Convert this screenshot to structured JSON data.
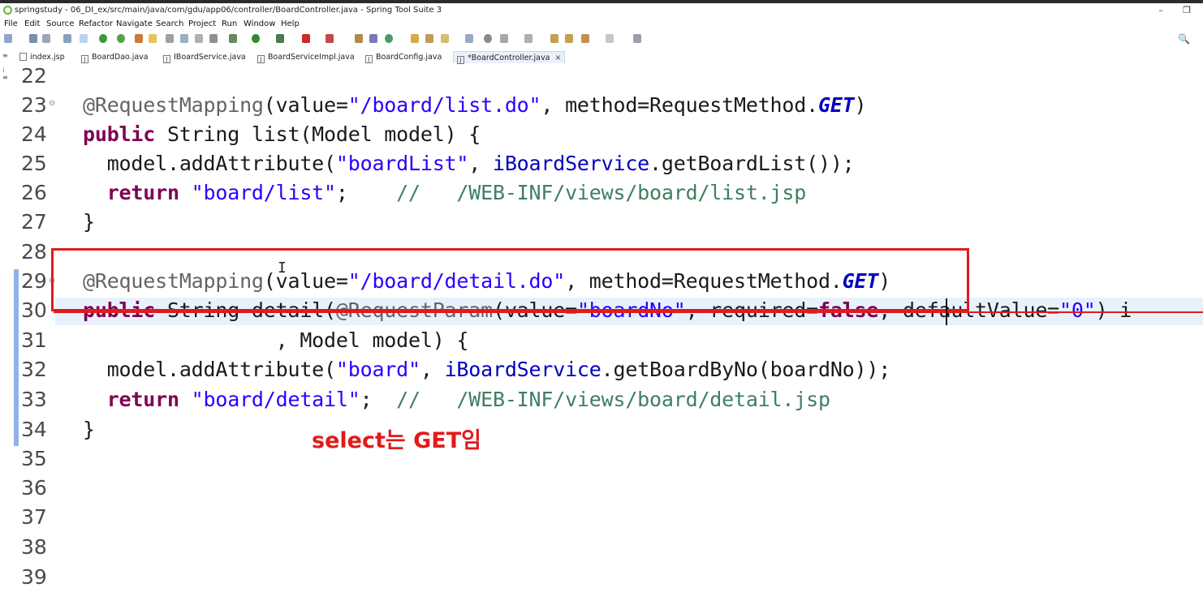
{
  "window": {
    "title": "springstudy - 06_DI_ex/src/main/java/com/gdu/app06/controller/BoardController.java - Spring Tool Suite 3",
    "minimize": "–",
    "restore": "❐"
  },
  "menu": [
    "File",
    "Edit",
    "Source",
    "Refactor",
    "Navigate",
    "Search",
    "Project",
    "Run",
    "Window",
    "Help"
  ],
  "toolbar": {
    "search_icon": "search-icon"
  },
  "tabs": [
    {
      "label": "index.jsp",
      "icon": "J"
    },
    {
      "label": "BoardDao.java",
      "icon": "J"
    },
    {
      "label": "IBoardService.java",
      "icon": "J"
    },
    {
      "label": "BoardServiceImpl.java",
      "icon": "J"
    },
    {
      "label": "BoardConfig.java",
      "icon": "J"
    },
    {
      "label": "*BoardController.java",
      "icon": "J",
      "close": "×"
    }
  ],
  "editor": {
    "line_numbers": [
      "22",
      "23",
      "24",
      "25",
      "26",
      "27",
      "28",
      "29",
      "30",
      "31",
      "32",
      "33",
      "34",
      "35",
      "36",
      "37",
      "38",
      "39"
    ],
    "fold_markers": {
      "23": "⊖",
      "29": "⊖"
    },
    "lines": {
      "l23": {
        "ann": "@RequestMapping",
        "a": "(value=",
        "s1": "\"/board/list.do\"",
        "b": ", method=RequestMethod.",
        "c": "GET",
        "d": ")"
      },
      "l24": {
        "kw": "public",
        "rest": " String list(Model ",
        "p": "model",
        "end": ") {"
      },
      "l25": {
        "ind": "  ",
        "p": "model",
        "a": ".addAttribute(",
        "s": "\"boardList\"",
        "b": ", ",
        "f": "iBoardService",
        "c": ".getBoardList());"
      },
      "l26": {
        "ind": "  ",
        "kw": "return",
        "sp": " ",
        "s": "\"board/list\"",
        "c": ";    ",
        "cm": "//   /WEB-INF/views/board/list.jsp"
      },
      "l27": {
        "t": "}"
      },
      "l29": {
        "ann": "@RequestMapping",
        "a": "(value=",
        "s1": "\"/board/detail.do\"",
        "b": ", method=RequestMethod.",
        "c": "GET",
        "d": ")"
      },
      "l30": {
        "kw": "public",
        "a": " String detail(",
        "ann": "@RequestParam",
        "b": "(value=",
        "s": "\"boardNo\"",
        "c": ", required=",
        "kw2": "false",
        "d": ", defaultValue=",
        "s2": "\"0\"",
        "e": ") i"
      },
      "l31": {
        "a": "                , Model ",
        "p": "model",
        "b": ") {"
      },
      "l32": {
        "ind": "  ",
        "p": "model",
        "a": ".addAttribute(",
        "s": "\"board\"",
        "b": ", ",
        "f": "iBoardService",
        "c": ".getBoardByNo(",
        "p2": "boardNo",
        "d": "));"
      },
      "l33": {
        "ind": "  ",
        "kw": "return",
        "sp": " ",
        "s": "\"board/detail\"",
        "c": ";  ",
        "cm": "//   /WEB-INF/views/board/detail.jsp"
      },
      "l34": {
        "t": "}"
      }
    }
  },
  "annotation": {
    "caption": "select는 GET임",
    "color": "#e01b1b"
  }
}
